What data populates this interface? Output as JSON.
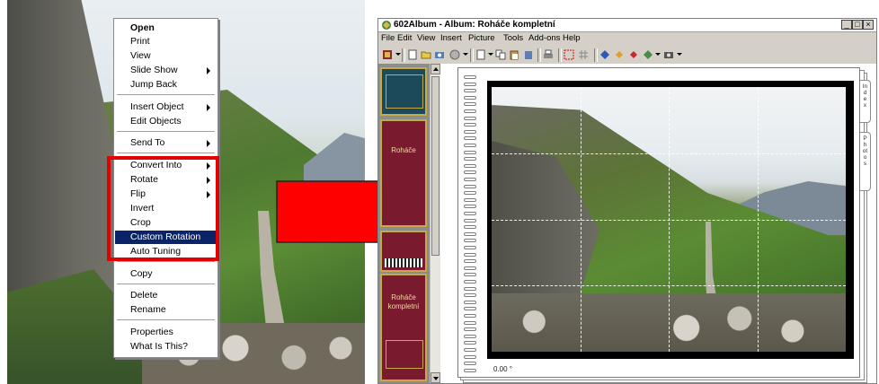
{
  "context_menu": {
    "items": [
      {
        "label": "Open",
        "bold": true,
        "submenu": false
      },
      {
        "label": "Print",
        "submenu": false
      },
      {
        "label": "View",
        "submenu": false
      },
      {
        "label": "Slide Show",
        "submenu": true
      },
      {
        "label": "Jump Back",
        "submenu": false
      },
      {
        "label": "Insert Object",
        "submenu": true
      },
      {
        "label": "Edit Objects",
        "submenu": false
      },
      {
        "label": "Send To",
        "submenu": true
      },
      {
        "label": "Convert Into",
        "submenu": true
      },
      {
        "label": "Rotate",
        "submenu": true
      },
      {
        "label": "Flip",
        "submenu": true
      },
      {
        "label": "Invert",
        "submenu": false
      },
      {
        "label": "Crop",
        "submenu": false
      },
      {
        "label": "Custom Rotation",
        "submenu": false,
        "highlighted": true
      },
      {
        "label": "Auto Tuning",
        "submenu": false
      },
      {
        "label": "Copy",
        "submenu": false
      },
      {
        "label": "Delete",
        "submenu": false
      },
      {
        "label": "Rename",
        "submenu": false
      },
      {
        "label": "Properties",
        "submenu": false
      },
      {
        "label": "What Is This?",
        "submenu": false
      }
    ]
  },
  "window": {
    "title": "602Album - Album: Roháče kompletní",
    "minimize": "_",
    "maximize": "□",
    "close": "×"
  },
  "menubar": [
    "File",
    "Edit",
    "View",
    "Insert",
    "Picture",
    "Tools",
    "Add-ons",
    "Help"
  ],
  "books": [
    {
      "label": ""
    },
    {
      "label": "Roháče"
    },
    {
      "label": ""
    },
    {
      "label": "Roháče kompletní"
    }
  ],
  "photo_view": {
    "rotation": "0.00 °"
  },
  "side_tabs": [
    "Index",
    "Photos"
  ],
  "colors": {
    "highlight": "#0a246a",
    "annotation_red": "#e30000",
    "arrow_red": "#ff0000"
  }
}
